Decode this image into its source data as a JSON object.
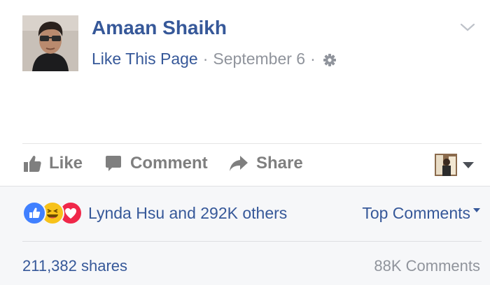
{
  "post": {
    "author_name": "Amaan Shaikh",
    "like_page_link": "Like This Page",
    "separator": "·",
    "date": "September 6",
    "privacy_icon": "gear-icon",
    "options_icon": "chevron-down-icon",
    "avatar_icon": "profile-photo"
  },
  "actions": {
    "like_label": "Like",
    "comment_label": "Comment",
    "share_label": "Share",
    "page_picker_icon": "page-avatar"
  },
  "feedback": {
    "reactions": [
      "like",
      "haha",
      "love"
    ],
    "reactors_text": "Lynda Hsu and 292K others",
    "top_comments_label": "Top Comments",
    "shares_text": "211,382 shares",
    "comments_text": "88K Comments"
  },
  "colors": {
    "link_blue": "#365899",
    "meta_gray": "#90949c",
    "action_gray": "#7f7f7f",
    "like_blue": "#4080ff",
    "haha_yellow": "#f7c21b",
    "love_red": "#f0284a",
    "feedback_bg": "#f6f7f9"
  }
}
